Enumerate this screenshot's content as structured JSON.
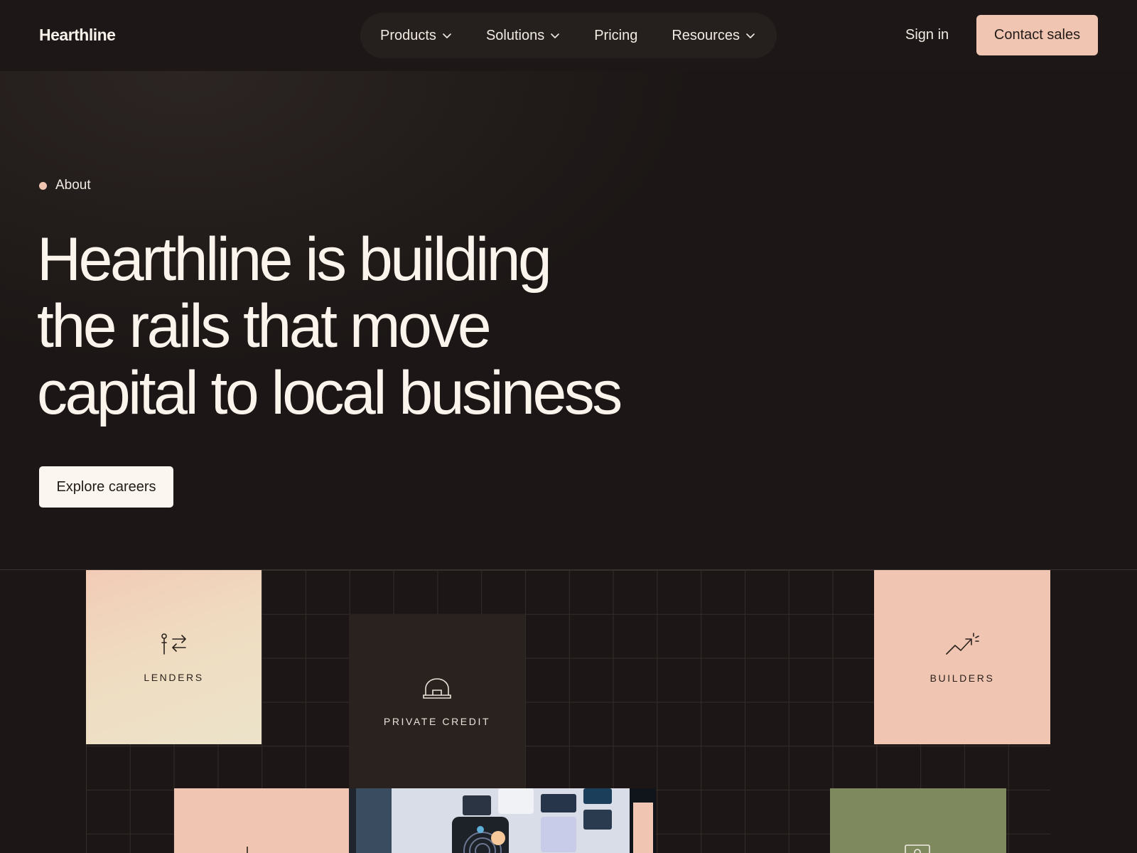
{
  "nav": {
    "logo": "Hearthline",
    "items": [
      {
        "label": "Products",
        "has_dropdown": true
      },
      {
        "label": "Solutions",
        "has_dropdown": true
      },
      {
        "label": "Pricing",
        "has_dropdown": false
      },
      {
        "label": "Resources",
        "has_dropdown": true
      }
    ],
    "sign_in": "Sign in",
    "contact": "Contact sales"
  },
  "hero": {
    "eyebrow": "About",
    "headline_lines": [
      "Hearthline is building",
      "the rails that move",
      "capital to local business"
    ],
    "cta": "Explore careers"
  },
  "tiles": {
    "lenders": {
      "label": "LENDERS",
      "icon": "lenders-exchange-icon"
    },
    "private_credit": {
      "label": "PRIVATE CREDIT",
      "icon": "building-icon"
    },
    "builders": {
      "label": "BUILDERS",
      "icon": "trend-up-sparkle-icon"
    }
  },
  "colors": {
    "background": "#1c1716",
    "accent": "#f0c6b3",
    "text": "#faf4ec",
    "tile_green": "#7e8a5e",
    "tile_dark": "#2a221f"
  }
}
